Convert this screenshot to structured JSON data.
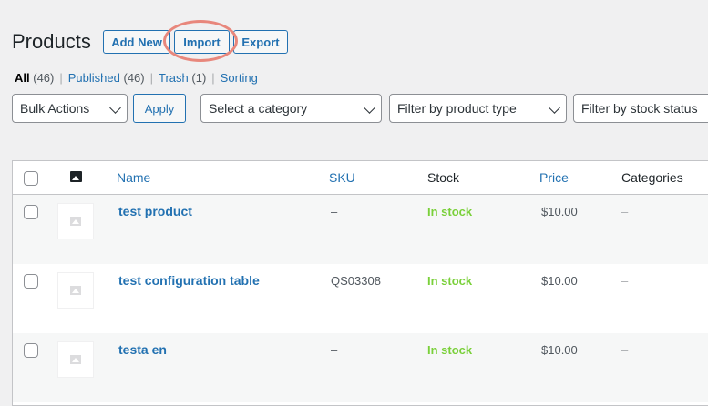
{
  "header": {
    "title": "Products",
    "add_new": "Add New",
    "import": "Import",
    "export": "Export"
  },
  "views": [
    {
      "label": "All",
      "count": "(46)"
    },
    {
      "label": "Published",
      "count": "(46)"
    },
    {
      "label": "Trash",
      "count": "(1)"
    },
    {
      "label": "Sorting",
      "count": ""
    }
  ],
  "filters": {
    "bulk_actions": "Bulk Actions",
    "apply": "Apply",
    "category": "Select a category",
    "product_type": "Filter by product type",
    "stock_status": "Filter by stock status"
  },
  "columns": {
    "name": "Name",
    "sku": "SKU",
    "stock": "Stock",
    "price": "Price",
    "categories": "Categories"
  },
  "rows": [
    {
      "name": "test product",
      "sku": "–",
      "stock": "In stock",
      "price": "$10.00",
      "categories": "–"
    },
    {
      "name": "test configuration table",
      "sku": "QS03308",
      "stock": "In stock",
      "price": "$10.00",
      "categories": "–"
    },
    {
      "name": "testa en",
      "sku": "–",
      "stock": "In stock",
      "price": "$10.00",
      "categories": "–"
    }
  ],
  "colors": {
    "link": "#2271b1",
    "in_stock": "#7ad03a",
    "highlight": "#e8877c"
  }
}
